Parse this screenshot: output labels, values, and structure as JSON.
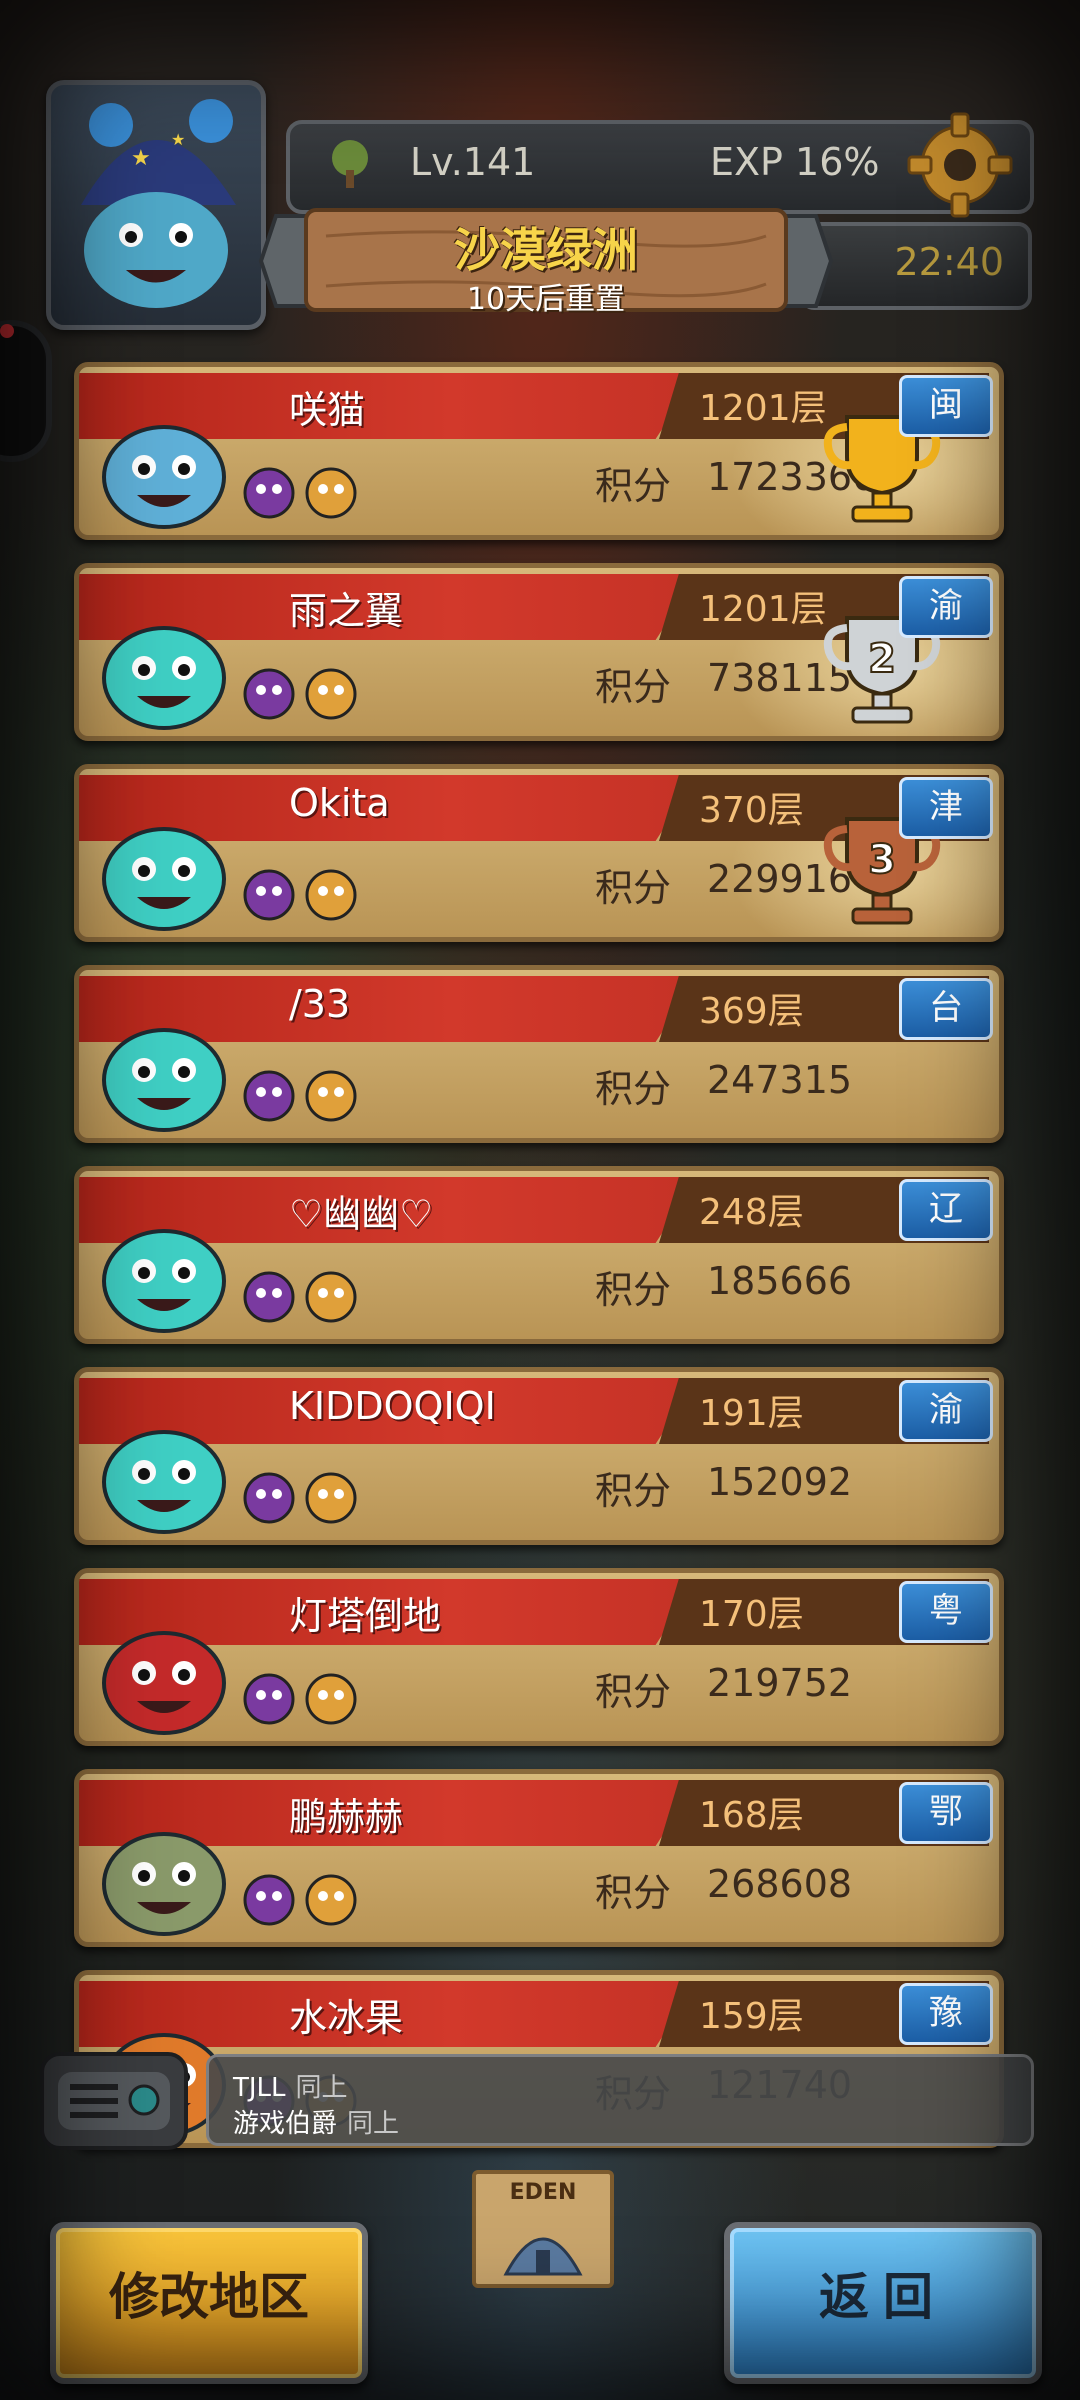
{
  "header": {
    "level_label": "Lv.141",
    "exp_label": "EXP 16%",
    "map_name": "沙漠绿洲",
    "reset_note": "10天后重置",
    "timer": "22:40"
  },
  "rankings": [
    {
      "name": "咲猫",
      "floor": "1201层",
      "score_label": "积分",
      "score": "1723360",
      "region": "闽",
      "trophy": "gold",
      "trophy_number": "",
      "avatar_color": "#5fb0d8"
    },
    {
      "name": "雨之翼",
      "floor": "1201层",
      "score_label": "积分",
      "score": "738115",
      "region": "渝",
      "trophy": "silver",
      "trophy_number": "2",
      "avatar_color": "#3fcfc4"
    },
    {
      "name": "Okita",
      "floor": "370层",
      "score_label": "积分",
      "score": "229916",
      "region": "津",
      "trophy": "bronze",
      "trophy_number": "3",
      "avatar_color": "#3fcfc4"
    },
    {
      "name": "/33",
      "floor": "369层",
      "score_label": "积分",
      "score": "247315",
      "region": "台",
      "trophy": "",
      "trophy_number": "",
      "avatar_color": "#3fcfc4"
    },
    {
      "name": "♡幽幽♡",
      "floor": "248层",
      "score_label": "积分",
      "score": "185666",
      "region": "辽",
      "trophy": "",
      "trophy_number": "",
      "avatar_color": "#3fcfc4"
    },
    {
      "name": "KIDDOQIQI",
      "floor": "191层",
      "score_label": "积分",
      "score": "152092",
      "region": "渝",
      "trophy": "",
      "trophy_number": "",
      "avatar_color": "#3fcfc4"
    },
    {
      "name": "灯塔倒地",
      "floor": "170层",
      "score_label": "积分",
      "score": "219752",
      "region": "粤",
      "trophy": "",
      "trophy_number": "",
      "avatar_color": "#c42a2a"
    },
    {
      "name": "鹏赫赫",
      "floor": "168层",
      "score_label": "积分",
      "score": "268608",
      "region": "鄂",
      "trophy": "",
      "trophy_number": "",
      "avatar_color": "#8a9a6a"
    },
    {
      "name": "水冰果",
      "floor": "159层",
      "score_label": "积分",
      "score": "121740",
      "region": "豫",
      "trophy": "",
      "trophy_number": "",
      "avatar_color": "#e07a2a"
    }
  ],
  "chat": [
    {
      "user": "TJLL",
      "message": "同上"
    },
    {
      "user": "游戏伯爵",
      "message": "同上"
    }
  ],
  "map_label": "EDEN",
  "buttons": {
    "change_region": "修改地区",
    "back": "返回"
  },
  "colors": {
    "gold": "#f2b21c",
    "silver": "#cfd3d6",
    "bronze": "#b8623a",
    "region_badge": "#2a73c0"
  }
}
